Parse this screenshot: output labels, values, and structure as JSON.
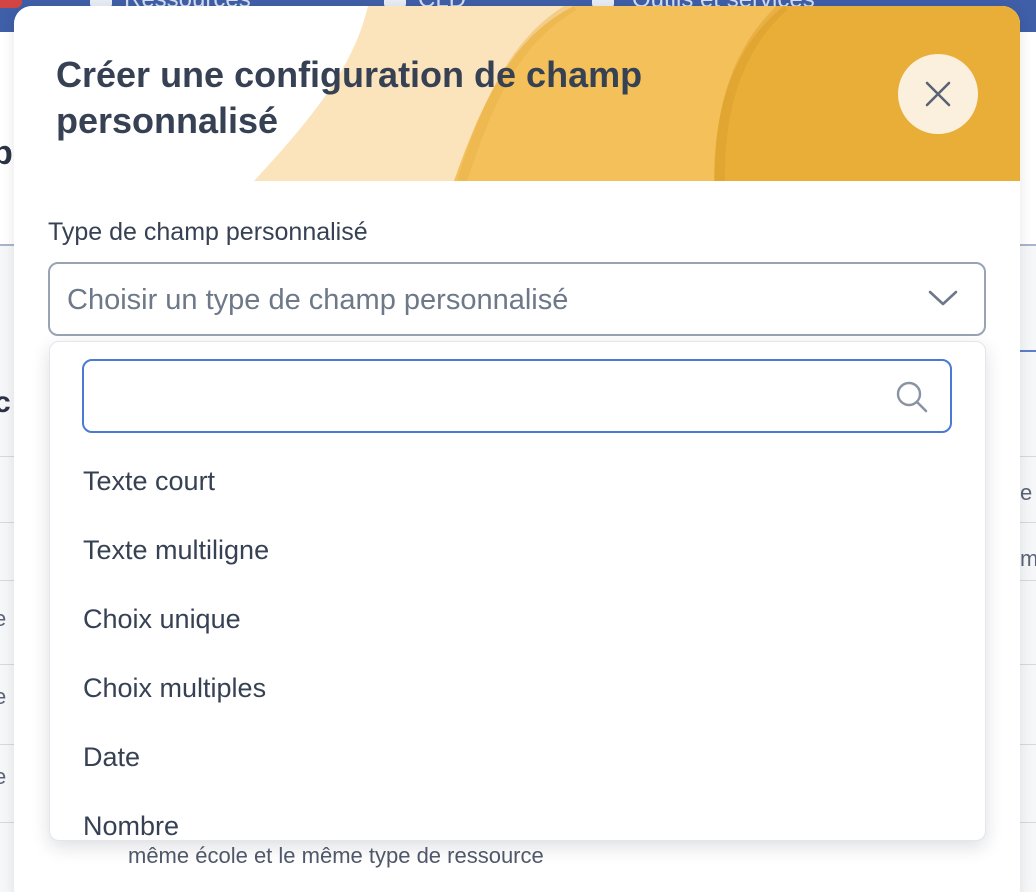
{
  "background": {
    "nav": {
      "items": [
        "Ressources",
        "CLD",
        "Outils et services"
      ]
    },
    "fragments": {
      "heading_letter": "p",
      "section_letter": "c",
      "right_e": "e",
      "right_m": "m",
      "left_e": "e"
    },
    "under_text": "même école et le même type de ressource"
  },
  "modal": {
    "title": "Créer une configuration de champ personnalisé",
    "close_icon": "close-icon",
    "field_label": "Type de champ personnalisé",
    "select": {
      "value": "Choisir un type de champ personnalisé",
      "icon": "chevron-down-icon"
    },
    "dropdown": {
      "search": {
        "value": "",
        "placeholder": "",
        "icon": "search-icon"
      },
      "options": [
        "Texte court",
        "Texte multiligne",
        "Choix unique",
        "Choix multiples",
        "Date",
        "Nombre"
      ]
    }
  },
  "colors": {
    "banner_light": "#fbe3bb",
    "banner_mid": "#f4c05a",
    "banner_dark": "#e8ae38",
    "accent_blue": "#4c79d6",
    "text": "#364154"
  }
}
